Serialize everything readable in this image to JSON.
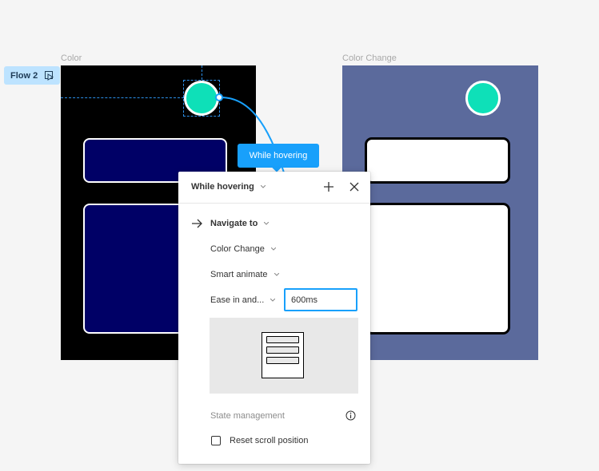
{
  "canvas": {
    "frames": [
      {
        "label": "Color"
      },
      {
        "label": "Color Change"
      }
    ],
    "flow_badge": {
      "label": "Flow 2",
      "icon": "play-icon"
    },
    "colors": {
      "canvas_bg": "#f5f5f5",
      "frame_color_bg": "#000000",
      "frame_color_change_bg": "#5b6a9c",
      "circle_fill": "#0ee0b8",
      "dark_rect_fill": "#000066",
      "accent": "#18a0fb",
      "selection": "#2b8fe8"
    }
  },
  "tooltip": {
    "label": "While hovering"
  },
  "panel": {
    "trigger": {
      "label": "While hovering",
      "icon": "chevron-down-icon"
    },
    "header_icons": [
      "plus-icon",
      "close-icon"
    ],
    "action": {
      "label": "Navigate to",
      "icon": "arrow-right-icon"
    },
    "destination": {
      "label": "Color Change"
    },
    "animation": {
      "label": "Smart animate"
    },
    "easing": {
      "label": "Ease in and..."
    },
    "duration": {
      "value": "600ms"
    },
    "state_management": {
      "label": "State management",
      "icon": "info-icon"
    },
    "reset_scroll": {
      "label": "Reset scroll position",
      "checked": false
    }
  }
}
